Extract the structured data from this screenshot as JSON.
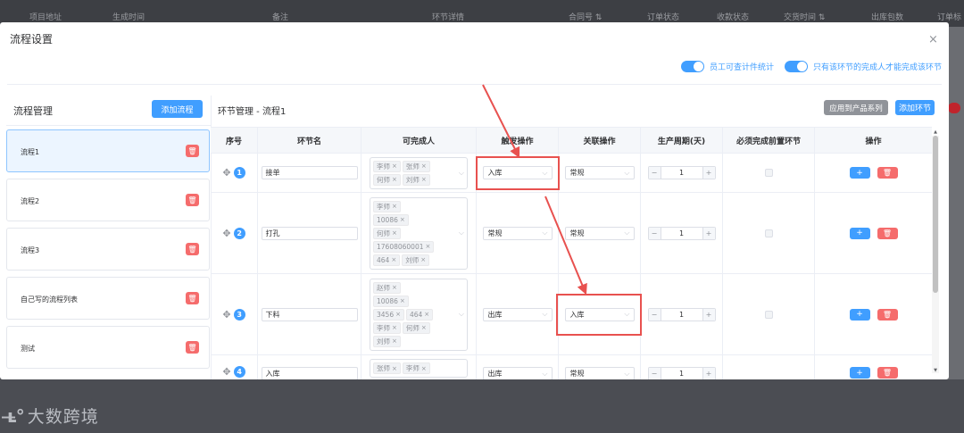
{
  "background": {
    "columns": [
      {
        "label": "项目地址"
      },
      {
        "label": "生成时间"
      },
      {
        "label": "备注"
      },
      {
        "label": "环节详情"
      },
      {
        "label": "合同号 ⇅"
      },
      {
        "label": "订单状态"
      },
      {
        "label": "收款状态"
      },
      {
        "label": "交货时间 ⇅"
      },
      {
        "label": "出库包数"
      },
      {
        "label": "订单标"
      }
    ]
  },
  "dialog": {
    "title": "流程设置",
    "close_icon": "×",
    "toggles": [
      {
        "label": "员工可查计件统计",
        "on": true
      },
      {
        "label": "只有该环节的完成人才能完成该环节",
        "on": true
      }
    ]
  },
  "left_panel": {
    "title": "流程管理",
    "add_button": "添加流程",
    "flows": [
      {
        "label": "流程1",
        "active": true
      },
      {
        "label": "流程2",
        "active": false
      },
      {
        "label": "流程3",
        "active": false
      },
      {
        "label": "自己写的流程列表",
        "active": false
      },
      {
        "label": "测试",
        "active": false
      }
    ]
  },
  "right_panel": {
    "title": "环节管理 - 流程1",
    "apply_button": "应用到产品系列",
    "add_button": "添加环节",
    "columns": [
      "序号",
      "环节名",
      "可完成人",
      "触发操作",
      "关联操作",
      "生产周期(天)",
      "必须完成前置环节",
      "操作"
    ],
    "rows": [
      {
        "index": "1",
        "name": "接单",
        "people": [
          "李师",
          "张师",
          "何师",
          "刘师"
        ],
        "trigger": "入库",
        "related": "常规",
        "cycle": "1"
      },
      {
        "index": "2",
        "name": "打孔",
        "people": [
          "李师",
          "10086",
          "何师",
          "17608060001",
          "464",
          "刘师"
        ],
        "trigger": "常规",
        "related": "常规",
        "cycle": "1"
      },
      {
        "index": "3",
        "name": "下料",
        "people": [
          "赵师",
          "10086",
          "3456",
          "464",
          "李师",
          "何师",
          "刘师"
        ],
        "trigger": "出库",
        "related": "入库",
        "cycle": "1"
      },
      {
        "index": "4",
        "name": "入库",
        "people": [
          "张师",
          "李师"
        ],
        "trigger": "出库",
        "related": "常规",
        "cycle": "1"
      }
    ]
  },
  "watermark": {
    "text": "大数跨境",
    "logo": "ʟ̶°"
  },
  "annotation_color": "#e8514f",
  "accent": "#409eff",
  "danger": "#f56c6c"
}
